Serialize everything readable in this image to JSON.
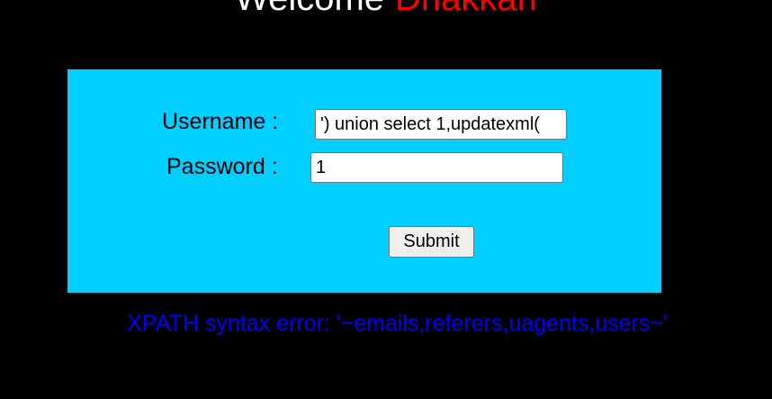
{
  "header": {
    "welcome_text": "Welcome",
    "user_name": "Dhakkan"
  },
  "login_form": {
    "username_label": "Username :",
    "username_value": "') union select 1,updatexml(",
    "password_label": "Password :",
    "password_value": "1",
    "submit_label": "Submit"
  },
  "result": {
    "error_message": "XPATH syntax error: '~emails,referers,uagents,users~'"
  },
  "colors": {
    "page_background": "#000000",
    "form_background": "#00cfff",
    "welcome_name": "#ff0000",
    "error_text": "#0000ff"
  }
}
